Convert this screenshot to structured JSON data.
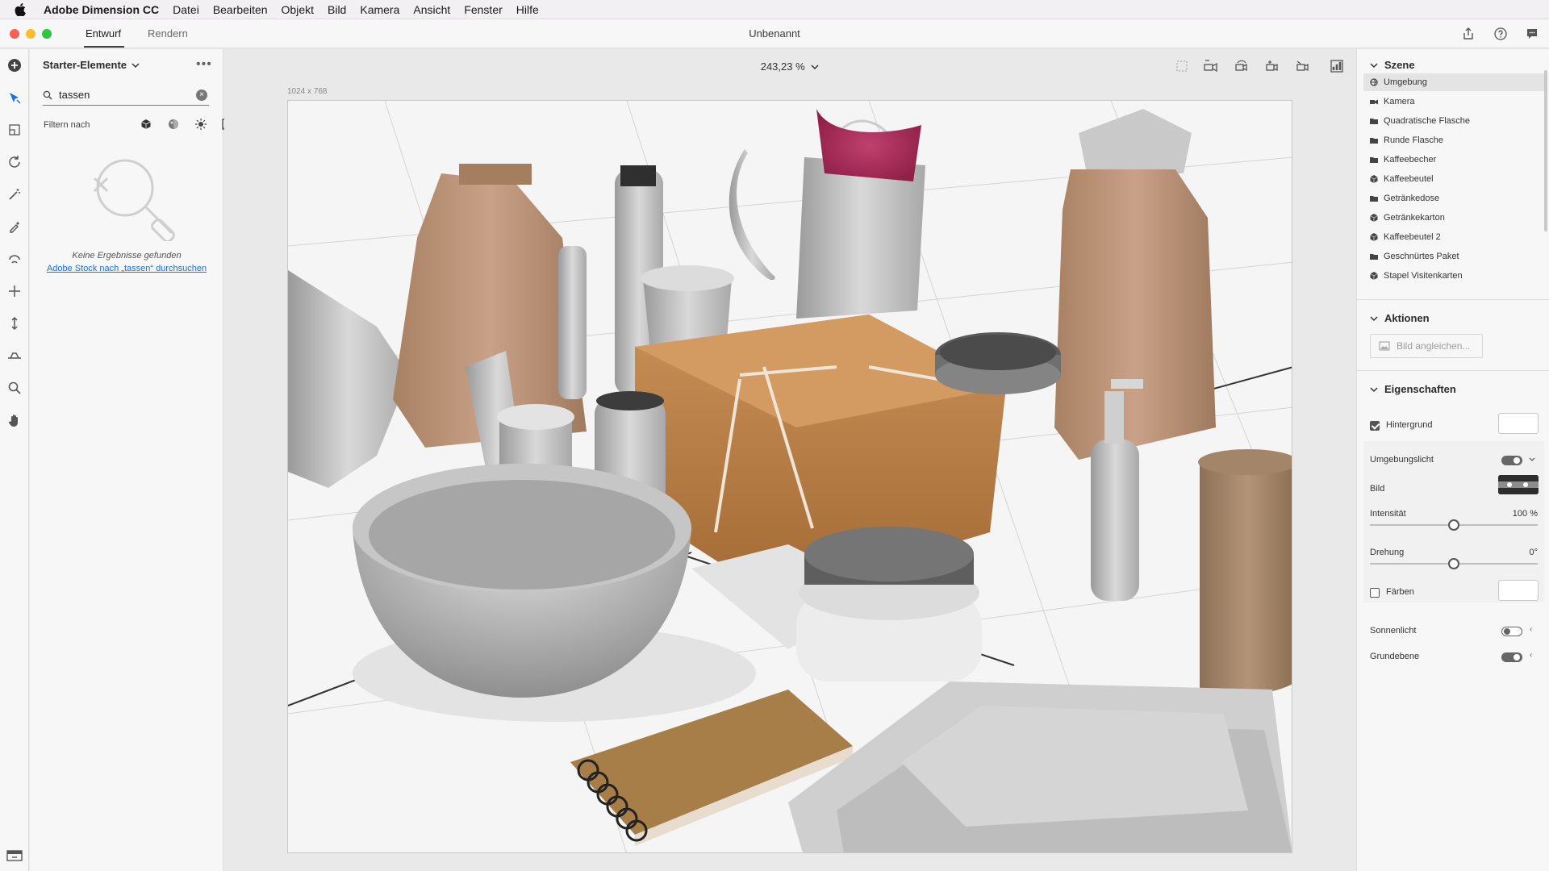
{
  "menubar": {
    "app_name": "Adobe Dimension CC",
    "items": [
      "Datei",
      "Bearbeiten",
      "Objekt",
      "Bild",
      "Kamera",
      "Ansicht",
      "Fenster",
      "Hilfe"
    ]
  },
  "titlebar": {
    "tabs": {
      "design": "Entwurf",
      "render": "Rendern"
    },
    "document_title": "Unbenannt"
  },
  "assets": {
    "header": "Starter-Elemente",
    "search": {
      "value": "tassen",
      "placeholder": ""
    },
    "filter_label": "Filtern nach",
    "no_results": "Keine Ergebnisse gefunden",
    "stock_link": "Adobe Stock nach „tassen“ durchsuchen"
  },
  "canvas": {
    "zoom": "243,23 %",
    "doc_size": "1024 x 768"
  },
  "scene": {
    "title": "Szene",
    "items": [
      {
        "label": "Umgebung",
        "icon": "environment-icon"
      },
      {
        "label": "Kamera",
        "icon": "camera-icon"
      },
      {
        "label": "Quadratische Flasche",
        "icon": "folder-icon"
      },
      {
        "label": "Runde Flasche",
        "icon": "folder-icon"
      },
      {
        "label": "Kaffeebecher",
        "icon": "folder-icon"
      },
      {
        "label": "Kaffeebeutel",
        "icon": "model-icon"
      },
      {
        "label": "Getränkedose",
        "icon": "folder-icon"
      },
      {
        "label": "Getränkekarton",
        "icon": "model-icon"
      },
      {
        "label": "Kaffeebeutel 2",
        "icon": "model-icon"
      },
      {
        "label": "Geschnürtes Paket",
        "icon": "folder-icon"
      },
      {
        "label": "Stapel Visitenkarten",
        "icon": "model-icon"
      }
    ]
  },
  "actions": {
    "title": "Aktionen",
    "match_image": "Bild angleichen..."
  },
  "properties": {
    "title": "Eigenschaften",
    "background": {
      "label": "Hintergrund",
      "checked": true
    },
    "environment_light": {
      "label": "Umgebungslicht",
      "on": true
    },
    "image_label": "Bild",
    "intensity": {
      "label": "Intensität",
      "value": "100 %"
    },
    "rotation": {
      "label": "Drehung",
      "value": "0°"
    },
    "tint": {
      "label": "Färben",
      "checked": false
    },
    "sunlight": {
      "label": "Sonnenlicht",
      "on": false
    },
    "ground_plane": {
      "label": "Grundebene",
      "on": true
    }
  },
  "colors": {
    "link": "#1473e6",
    "accent": "#555555",
    "panel": "#f7f7f7"
  }
}
